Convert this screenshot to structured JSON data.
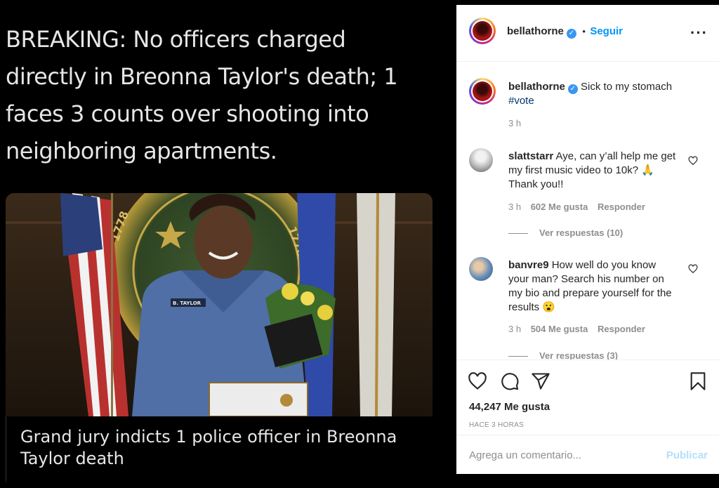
{
  "tweet": {
    "headline": "BREAKING: No officers charged directly in Breonna Taylor's death; 1 faces 3 counts over shooting into neighboring apartments.",
    "card_caption": "Grand jury indicts 1 police officer in Breonna Taylor death",
    "photo_badge": "B. TAYLOR",
    "seal_year": "1778"
  },
  "post": {
    "username": "bellathorne",
    "verified_icon": "verified-badge-icon",
    "separator": "•",
    "follow_label": "Seguir",
    "more_icon": "more-options-icon"
  },
  "caption": {
    "username": "bellathorne",
    "text": "Sick to my stomach",
    "hashtag": "#vote",
    "time": "3 h"
  },
  "comments": [
    {
      "username": "slattstarr",
      "text": "Aye, can y’all help me get my first music video to 10k? 🙏 Thank you!!",
      "time": "3 h",
      "likes": "602 Me gusta",
      "reply_label": "Responder",
      "view_replies": "Ver respuestas (10)"
    },
    {
      "username": "banvre9",
      "text": "How well do you know your man? Search his number on my bio and prepare yourself for the results 😮",
      "time": "3 h",
      "likes": "504 Me gusta",
      "reply_label": "Responder",
      "view_replies": "Ver respuestas (3)"
    }
  ],
  "actions": {
    "likes_count": "44,247 Me gusta",
    "posted_time": "HACE 3 HORAS",
    "icons": [
      "heart-icon",
      "comment-icon",
      "share-icon",
      "bookmark-icon"
    ]
  },
  "add_comment": {
    "placeholder": "Agrega un comentario...",
    "publish_label": "Publicar"
  },
  "colors": {
    "link_blue": "#0095f6",
    "verified_blue": "#3897f0",
    "muted_gray": "#8e8e8e",
    "publish_disabled": "#b2dffc"
  }
}
